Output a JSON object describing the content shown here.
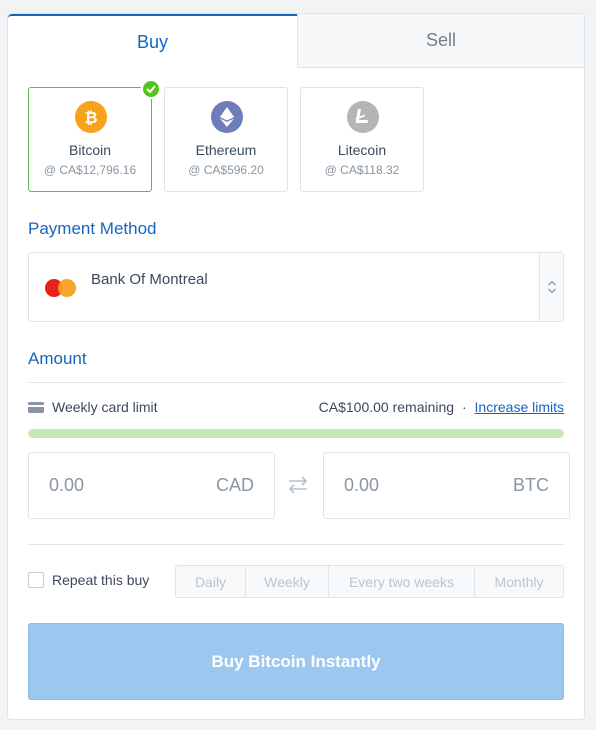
{
  "tabs": [
    {
      "label": "Buy",
      "active": true
    },
    {
      "label": "Sell",
      "active": false
    }
  ],
  "coins": [
    {
      "name": "Bitcoin",
      "price": "@ CA$12,796.16",
      "icon": "bitcoin-icon",
      "color": "#f7a21b",
      "selected": true
    },
    {
      "name": "Ethereum",
      "price": "@ CA$596.20",
      "icon": "ethereum-icon",
      "color": "#6f7cba",
      "selected": false
    },
    {
      "name": "Litecoin",
      "price": "@ CA$118.32",
      "icon": "litecoin-icon",
      "color": "#b5b5b5",
      "selected": false
    }
  ],
  "payment": {
    "title": "Payment Method",
    "selected": "Bank Of Montreal",
    "icon": "mastercard-icon"
  },
  "amount": {
    "title": "Amount",
    "limit_label": "Weekly card limit",
    "remaining": "CA$100.00 remaining",
    "separator": "·",
    "increase_link": "Increase limits",
    "progress_fraction": 1.0,
    "fiat_value": "0.00",
    "fiat_unit": "CAD",
    "crypto_value": "0.00",
    "crypto_unit": "BTC"
  },
  "repeat": {
    "label": "Repeat this buy",
    "options": [
      "Daily",
      "Weekly",
      "Every two weeks",
      "Monthly"
    ]
  },
  "submit_label": "Buy Bitcoin Instantly",
  "colors": {
    "accent": "#1565c0",
    "selected_border": "#5cb85c",
    "check": "#52c41a",
    "button": "#9cc8f0"
  }
}
